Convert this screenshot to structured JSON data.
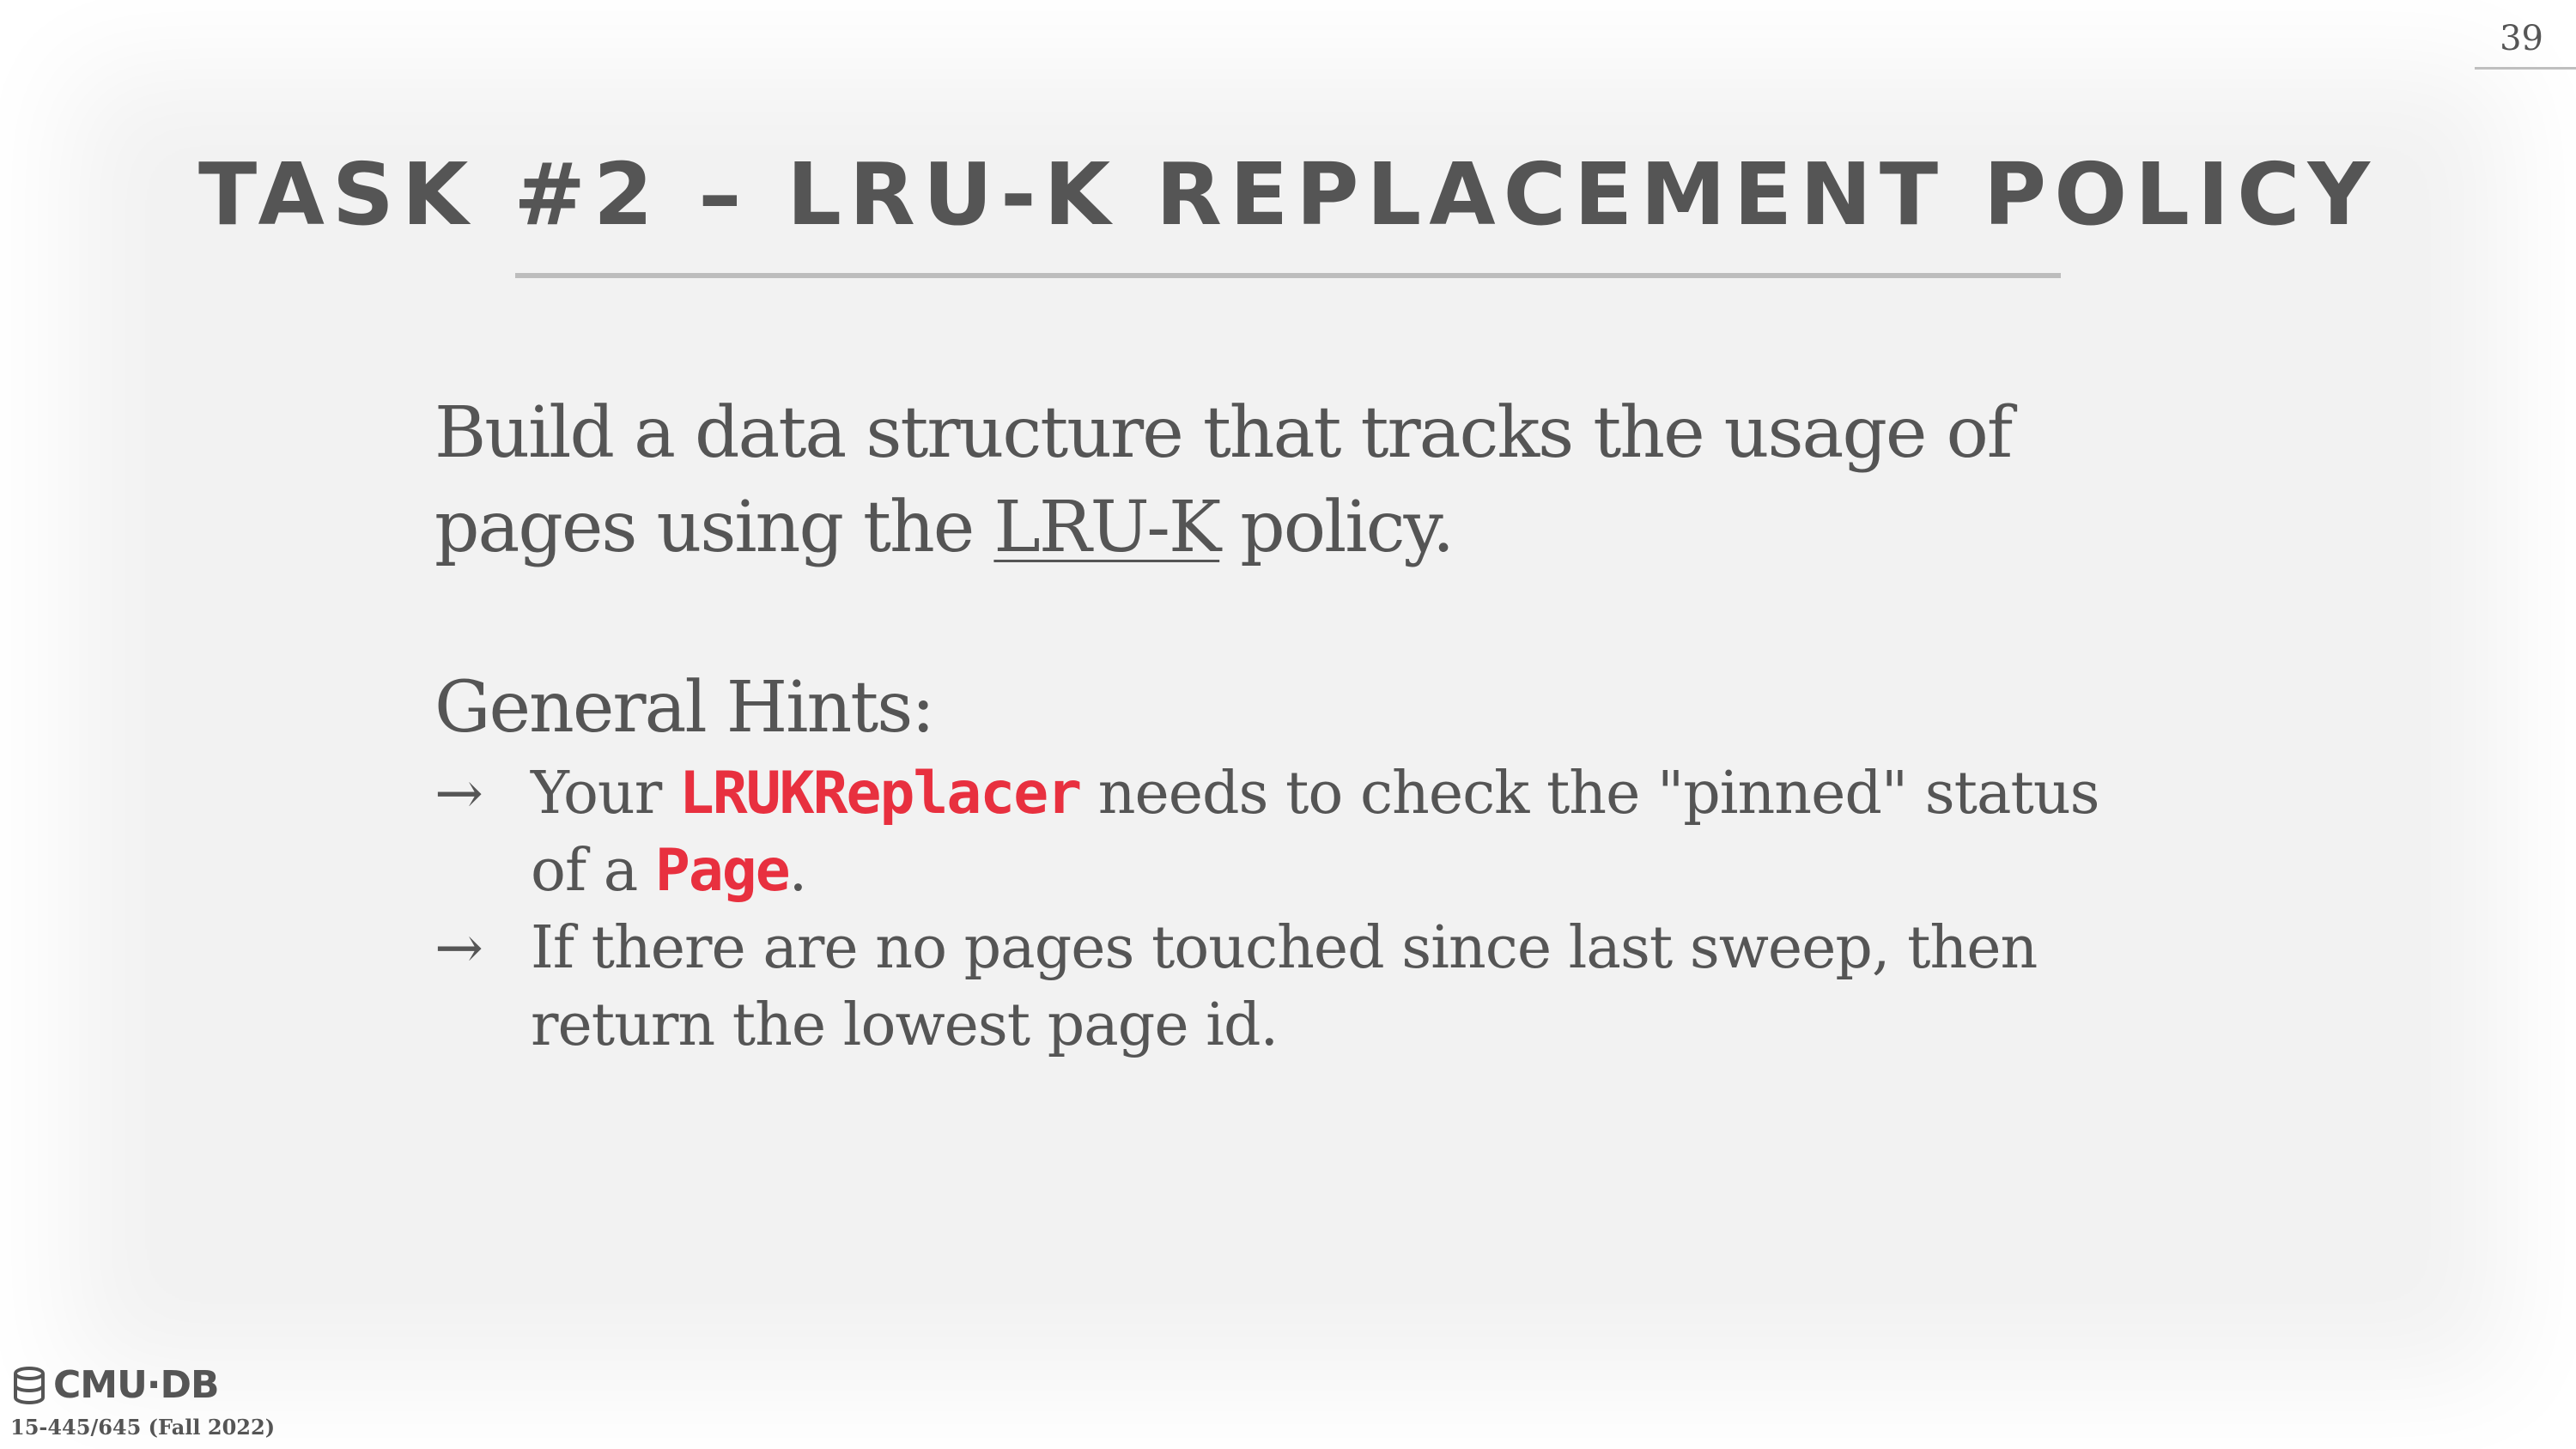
{
  "slide": {
    "page_number": "39",
    "title": "TASK #2 – LRU-K REPLACEMENT POLICY"
  },
  "intro": {
    "text_before": "Build a data structure that tracks the usage of pages using the ",
    "underlined": "LRU-K",
    "text_after": " policy."
  },
  "hints": {
    "heading": "General Hints:",
    "arrow_glyph": "→",
    "item1": {
      "before": "Your ",
      "code1": "LRUKReplacer",
      "middle": " needs to check the \"pinned\" status of a ",
      "code2": "Page",
      "after": "."
    },
    "item2": {
      "text": "If there are no pages touched since last sweep, then return the lowest page id."
    }
  },
  "footer": {
    "logo_text": "CMU·DB",
    "course": "15-445/645 (Fall 2022)"
  },
  "colors": {
    "text": "#555555",
    "code_highlight": "#e8303f",
    "background": "#f2f2f2",
    "rule": "#bdbdbd"
  }
}
